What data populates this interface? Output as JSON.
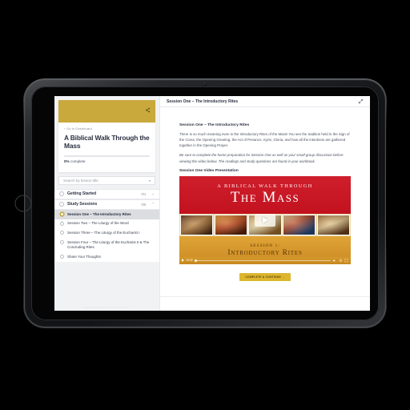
{
  "device": {
    "type": "tablet",
    "frame_color": "#16181a"
  },
  "sidebar": {
    "back_link": "Go to Dashboard",
    "back_chevron": "‹",
    "course_title": "A Biblical Walk Through the Mass",
    "progress_percent": "0%",
    "progress_value": 0,
    "progress_label_suffix": " complete",
    "share_icon": "share-icon",
    "search": {
      "placeholder": "Search by lesson title",
      "value": "",
      "caret": "▾"
    },
    "sections": [
      {
        "name": "Getting Started",
        "count": "0/1",
        "chevron": "⌄",
        "expanded": false,
        "lessons": []
      },
      {
        "name": "Study Sessions",
        "count": "0/5",
        "chevron": "⌃",
        "expanded": true,
        "lessons": [
          {
            "name": "Session One – The Introductory Rites",
            "active": true
          },
          {
            "name": "Session Two – The Liturgy of the Word",
            "active": false
          },
          {
            "name": "Session Three – The Liturgy of the Eucharist I",
            "active": false
          },
          {
            "name": "Session Four – The Liturgy of the Eucharist II & The Concluding Rites",
            "active": false
          },
          {
            "name": "Share Your Thoughts",
            "active": false
          }
        ]
      }
    ],
    "footer_text": "• • •   • • • • • • • • •   • • • • • • • • • • •   • • • • • •"
  },
  "main": {
    "header_title": "Session One – The Introductory Rites",
    "expand_icon": "expand-arrows-icon",
    "heading": "Session One – The Introductory Rites",
    "paragraph": "There is so much meaning even in the Introductory Rites of the Mass! You see the tradition held in the Sign of the Cross, the Opening Greeting, the Act of Penance, Kyrie, Gloria, and how all the intentions are gathered together in the Opening Prayer.",
    "emphasis": "Be sure to complete the home preparation for Session One as well as your small-group discussion before viewing the video below. The readings and study questions are found in your workbook.",
    "subheading": "Session One Video Presentation",
    "complete_button": "COMPLETE & CONTINUE →"
  },
  "video": {
    "title_small": "A Biblical Walk Through",
    "title_large": "The Mass",
    "session_label": "Session 1:",
    "session_title": "Introductory Rites",
    "play_icon": "play-icon",
    "duration": "28:55",
    "controls": {
      "play_icon": "play-icon",
      "volume_icon": "volume-icon",
      "settings_icon": "gear-icon",
      "fullscreen_icon": "fullscreen-icon"
    },
    "thumbnails": [
      "nativity-thumbnail",
      "crucifixion-thumbnail",
      "altar-thumbnail",
      "annunciation-thumbnail",
      "last-supper-thumbnail"
    ]
  },
  "colors": {
    "gold": "#c9a93c",
    "video_red": "#c8121f",
    "video_gold": "#d4962c",
    "button_gold": "#dcb62e",
    "sidebar_bg": "#f1f2f4"
  }
}
